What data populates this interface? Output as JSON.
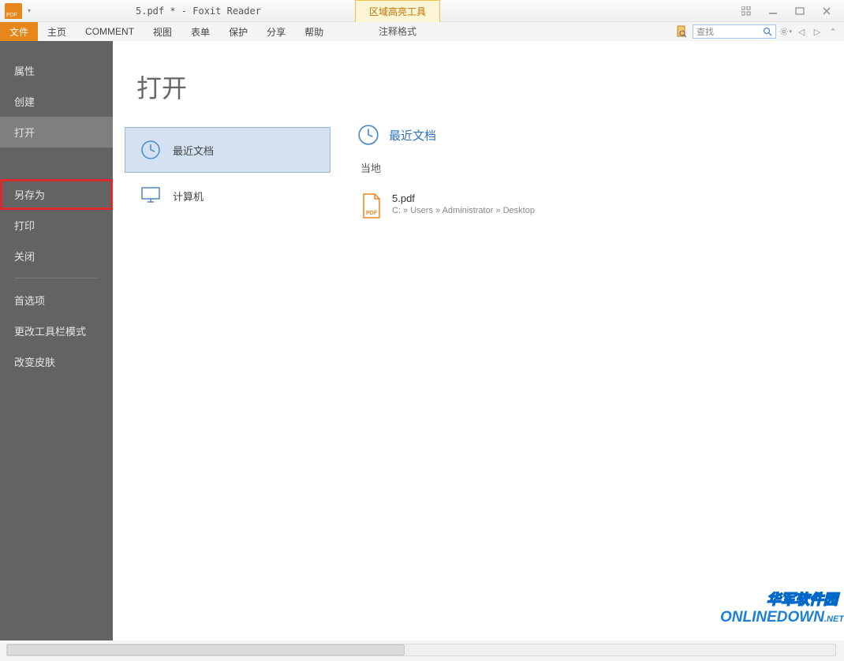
{
  "title": "5.pdf * - Foxit Reader",
  "context_tab": {
    "header": "区域高亮工具",
    "sub": "注释格式"
  },
  "tabs": [
    "文件",
    "主页",
    "COMMENT",
    "视图",
    "表单",
    "保护",
    "分享",
    "帮助"
  ],
  "active_tab_index": 0,
  "search": {
    "placeholder": "查找"
  },
  "sidebar": {
    "items": [
      {
        "label": "属性"
      },
      {
        "label": "创建"
      },
      {
        "label": "打开",
        "active": true
      },
      {
        "label": "另存为",
        "highlight": true
      },
      {
        "label": "打印"
      },
      {
        "label": "关闭"
      },
      {
        "label": "首选项"
      },
      {
        "label": "更改工具栏模式"
      },
      {
        "label": "改变皮肤"
      }
    ]
  },
  "backstage": {
    "title": "打开",
    "options": [
      {
        "label": "最近文档",
        "icon": "clock",
        "selected": true
      },
      {
        "label": "计算机",
        "icon": "computer"
      }
    ],
    "right": {
      "heading": "最近文档",
      "sub": "当地",
      "docs": [
        {
          "name": "5.pdf",
          "path": "C: » Users » Administrator » Desktop"
        }
      ]
    }
  },
  "watermark": {
    "line1": "华军软件园",
    "line2": "ONLINEDOWN",
    "suffix": ".NET"
  }
}
